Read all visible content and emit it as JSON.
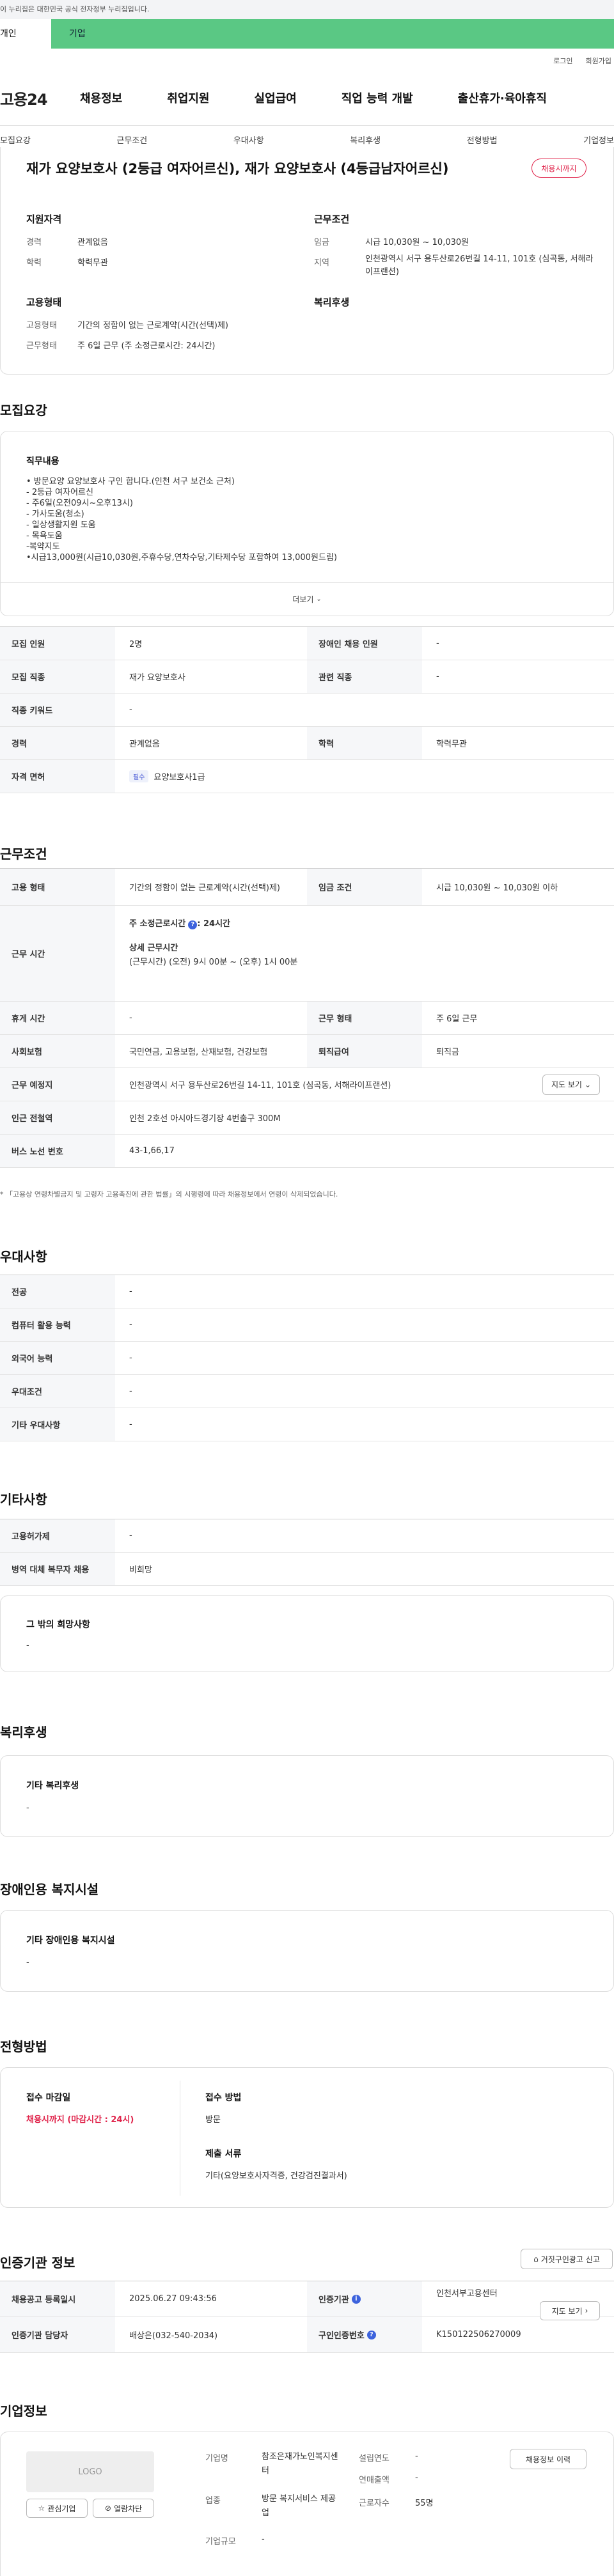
{
  "gov_banner": "이 누리집은 대한민국 공식 전자정부 누리집입니다.",
  "top_tabs": [
    "개인",
    "기업"
  ],
  "util": [
    "로그인",
    "회원가입"
  ],
  "logo": "고용24",
  "gnb": [
    "채용정보",
    "취업지원",
    "실업급여",
    "직업 능력 개발",
    "출산휴가·육아휴직"
  ],
  "lnb": [
    "모집요강",
    "근무조건",
    "우대사항",
    "복리후생",
    "전형방법",
    "기업정보"
  ],
  "job": {
    "title": "재가 요양보호사 (2등급 여자어르신), 재가 요양보호사 (4등급남자어르신)",
    "status_badge": "채용시까지",
    "qualification": {
      "heading": "지원자격",
      "rows": [
        {
          "label": "경력",
          "value": "관계없음"
        },
        {
          "label": "학력",
          "value": "학력무관"
        }
      ]
    },
    "conditions": {
      "heading": "근무조건",
      "rows": [
        {
          "label": "임금",
          "value": "시급 10,030원 ~ 10,030원"
        },
        {
          "label": "지역",
          "value": "인천광역시 서구 용두산로26번길 14-11, 101호 (심곡동, 서해라이프랜션)"
        }
      ]
    },
    "employment": {
      "heading": "고용형태",
      "rows": [
        {
          "label": "고용형태",
          "value": "기간의 정함이 없는 근로계약(시간(선택)제)"
        },
        {
          "label": "근무형태",
          "value": "주 6일 근무 (주 소정근로시간: 24시간)"
        }
      ]
    },
    "welfare_heading": "복리후생"
  },
  "recruit": {
    "heading": "모집요강",
    "duty_title": "직무내용",
    "duty_lines": [
      "• 방문요양 요양보호사 구인 합니다.(인천 서구 보건소 근처)",
      "- 2등급 여자어르신",
      "- 주6일(오전09시~오후13시)",
      "- 가사도움(청소)",
      "- 일상생활지원 도움",
      "- 목욕도움",
      "-복약지도",
      "•시급13,000원(시급10,030원,주휴수당,연차수당,기타제수당 포함하여 13,000원드림)"
    ],
    "more": "더보기",
    "rows": [
      {
        "th": "모집 인원",
        "td": "2명",
        "th2": "장애인 채용 인원",
        "td2": "-"
      },
      {
        "th": "모집 직종",
        "td": "재가 요양보호사",
        "th2": "관련 직종",
        "td2": "-"
      },
      {
        "th": "직종 키워드",
        "td": "-"
      },
      {
        "th": "경력",
        "td": "관계없음",
        "th2": "학력",
        "td2": "학력무관"
      }
    ],
    "license_th": "자격 면허",
    "license_chip": "필수",
    "license_value": "요양보호사1급"
  },
  "work": {
    "heading": "근무조건",
    "employ_th": "고용 형태",
    "employ_td": "기간의 정함이 없는 근로계약(시간(선택)제)",
    "wage_th": "임금 조건",
    "wage_td": "시급 10,030원 ~ 10,030원 이하",
    "hours_th": "근무 시간",
    "hours_total": "주 소정근로시간",
    "hours_total_value": ": 24시간",
    "hours_detail_title": "상세 근무시간",
    "hours_detail": "(근무시간) (오전) 9시 00분 ~ (오후) 1시 00분",
    "rest_th": "휴게 시간",
    "rest_td": "-",
    "type_th": "근무 형태",
    "type_td": "주 6일 근무",
    "ins_th": "사회보험",
    "ins_td": "국민연금, 고용보험, 산재보험, 건강보험",
    "sev_th": "퇴직급여",
    "sev_td": "퇴직금",
    "place_th": "근무 예정지",
    "place_td": "인천광역시 서구 용두산로26번길 14-11, 101호 (심곡동, 서해라이프랜션)",
    "map_btn": "지도 보기",
    "subway_th": "인근 전철역",
    "subway_td": "인천 2호선 아시아드경기장 4번출구 300M",
    "bus_th": "버스 노선 번호",
    "bus_td": "43-1,66,17",
    "notice": "* 「고용상 연령차별금지 및 고령자 고용촉진에 관한 법률」의 시행령에 따라 채용정보에서 연령이 삭제되었습니다."
  },
  "pref": {
    "heading": "우대사항",
    "rows": [
      {
        "th": "전공",
        "td": "-"
      },
      {
        "th": "컴퓨터 활용 능력",
        "td": "-"
      },
      {
        "th": "외국어 능력",
        "td": "-"
      },
      {
        "th": "우대조건",
        "td": "-"
      },
      {
        "th": "기타 우대사항",
        "td": "-"
      }
    ]
  },
  "etc": {
    "heading": "기타사항",
    "rows": [
      {
        "th": "고용허가제",
        "td": "-"
      },
      {
        "th": "병역 대체 복무자 채용",
        "td": "비희망"
      }
    ],
    "box_title": "그 밖의 희망사항",
    "box_value": "-"
  },
  "welfare": {
    "heading": "복리후생",
    "box_title": "기타 복리후생",
    "box_value": "-"
  },
  "disabled": {
    "heading": "장애인용 복지시설",
    "box_title": "기타 장애인용 복지시설",
    "box_value": "-"
  },
  "process": {
    "heading": "전형방법",
    "deadline_label": "접수 마감일",
    "deadline_value": "채용시까지 (마감시간 : 24시)",
    "method_label": "접수 방법",
    "method_value": "방문",
    "docs_label": "제출 서류",
    "docs_value": "기타(요양보호사자격증, 건강검진결과서)"
  },
  "cert": {
    "heading": "인증기관 정보",
    "report_btn": "거짓구인광고 신고",
    "reg_th": "채용공고 등록일시",
    "reg_td": "2025.06.27 09:43:56",
    "agency_th": "인증기관",
    "agency_td": "인천서부고용센터",
    "map_btn": "지도 보기",
    "contact_th": "인증기관 담당자",
    "contact_td": "배상은(032-540-2034)",
    "num_th": "구인인증번호",
    "num_td": "K150122506270009"
  },
  "company": {
    "heading": "기업정보",
    "logo_text": "LOGO",
    "interest_btn": "관심기업",
    "block_btn": "열람차단",
    "name_label": "기업명",
    "name_value": "참조은재가노인복지센터",
    "industry_label": "업종",
    "industry_value": "방문 복지서비스 제공업",
    "size_label": "기업규모",
    "size_value": "-",
    "founded_label": "설립연도",
    "founded_value": "-",
    "sales_label": "연매출액",
    "sales_value": "-",
    "emp_label": "근로자수",
    "emp_value": "55명",
    "jobs_btn": "채용정보 이력"
  },
  "colors": {
    "accent_green": "#5ac884",
    "deadline_red": "#e0244b",
    "info_blue": "#3d63dd"
  }
}
